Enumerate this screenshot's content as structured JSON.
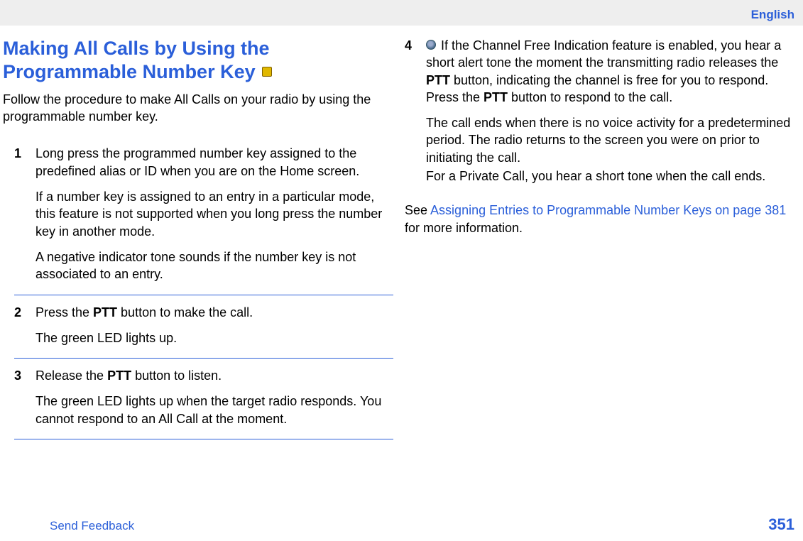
{
  "header": {
    "language": "English"
  },
  "title_line1": "Making All Calls by Using the",
  "title_line2": "Programmable Number Key ",
  "intro": "Follow the procedure to make All Calls on your radio by using the programmable number key.",
  "steps": {
    "s1": {
      "num": "1",
      "p1": "Long press the programmed number key assigned to the predefined alias or ID when you are on the Home screen.",
      "p2": "If a number key is assigned to an entry in a particular mode, this feature is not supported when you long press the number key in another mode.",
      "p3": "A negative indicator tone sounds if the number key is not associated to an entry."
    },
    "s2": {
      "num": "2",
      "p1a": "Press the ",
      "p1b": "PTT",
      "p1c": " button to make the call.",
      "p2": "The green LED lights up."
    },
    "s3": {
      "num": "3",
      "p1a": "Release the ",
      "p1b": "PTT",
      "p1c": " button to listen.",
      "p2": "The green LED lights up when the target radio responds. You cannot respond to an All Call at the moment."
    },
    "s4": {
      "num": "4",
      "p1a": " If the Channel Free Indication feature is enabled, you hear a short alert tone the moment the transmitting radio releases the ",
      "p1b": "PTT",
      "p1c": " button, indicating the channel is free for you to respond. Press the ",
      "p1d": "PTT",
      "p1e": " button to respond to the call.",
      "p2a": "The call ends when there is no voice activity for a predetermined period. The radio returns to the screen you were on prior to initiating the call.",
      "p2b": "For a Private Call, you hear a short tone when the call ends."
    }
  },
  "see": {
    "prefix": "See ",
    "link": "Assigning Entries to Programmable Number Keys on page 381",
    "suffix": " for more information."
  },
  "footer": {
    "feedback": "Send Feedback",
    "page": "351"
  }
}
